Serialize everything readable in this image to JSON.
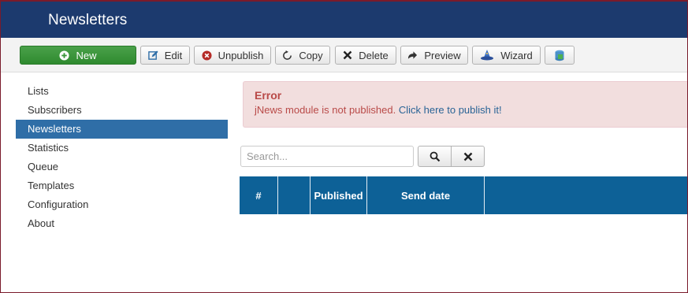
{
  "header": {
    "title": "Newsletters"
  },
  "toolbar": {
    "buttons": [
      {
        "label": "New",
        "icon": "plus-circle-icon"
      },
      {
        "label": "Edit",
        "icon": "edit-icon"
      },
      {
        "label": "Unpublish",
        "icon": "x-circle-icon"
      },
      {
        "label": "Copy",
        "icon": "refresh-icon"
      },
      {
        "label": "Delete",
        "icon": "x-icon"
      },
      {
        "label": "Preview",
        "icon": "share-arrow-icon"
      },
      {
        "label": "Wizard",
        "icon": "wizard-hat-icon"
      },
      {
        "label": "",
        "icon": "database-icon"
      }
    ],
    "colors": {
      "new_button": "#3a963a",
      "header": "#1c3a6e"
    }
  },
  "sidebar": {
    "items": [
      {
        "label": "Lists"
      },
      {
        "label": "Subscribers"
      },
      {
        "label": "Newsletters",
        "active": true
      },
      {
        "label": "Statistics"
      },
      {
        "label": "Queue"
      },
      {
        "label": "Templates"
      },
      {
        "label": "Configuration"
      },
      {
        "label": "About"
      }
    ],
    "active_color": "#2f6ea7"
  },
  "alert": {
    "title": "Error",
    "message": "jNews module is not published.",
    "link": "Click here to publish it!"
  },
  "search": {
    "placeholder": "Search..."
  },
  "table": {
    "columns": [
      "#",
      "",
      "Published",
      "Send date",
      ""
    ],
    "header_color": "#0d6197"
  }
}
